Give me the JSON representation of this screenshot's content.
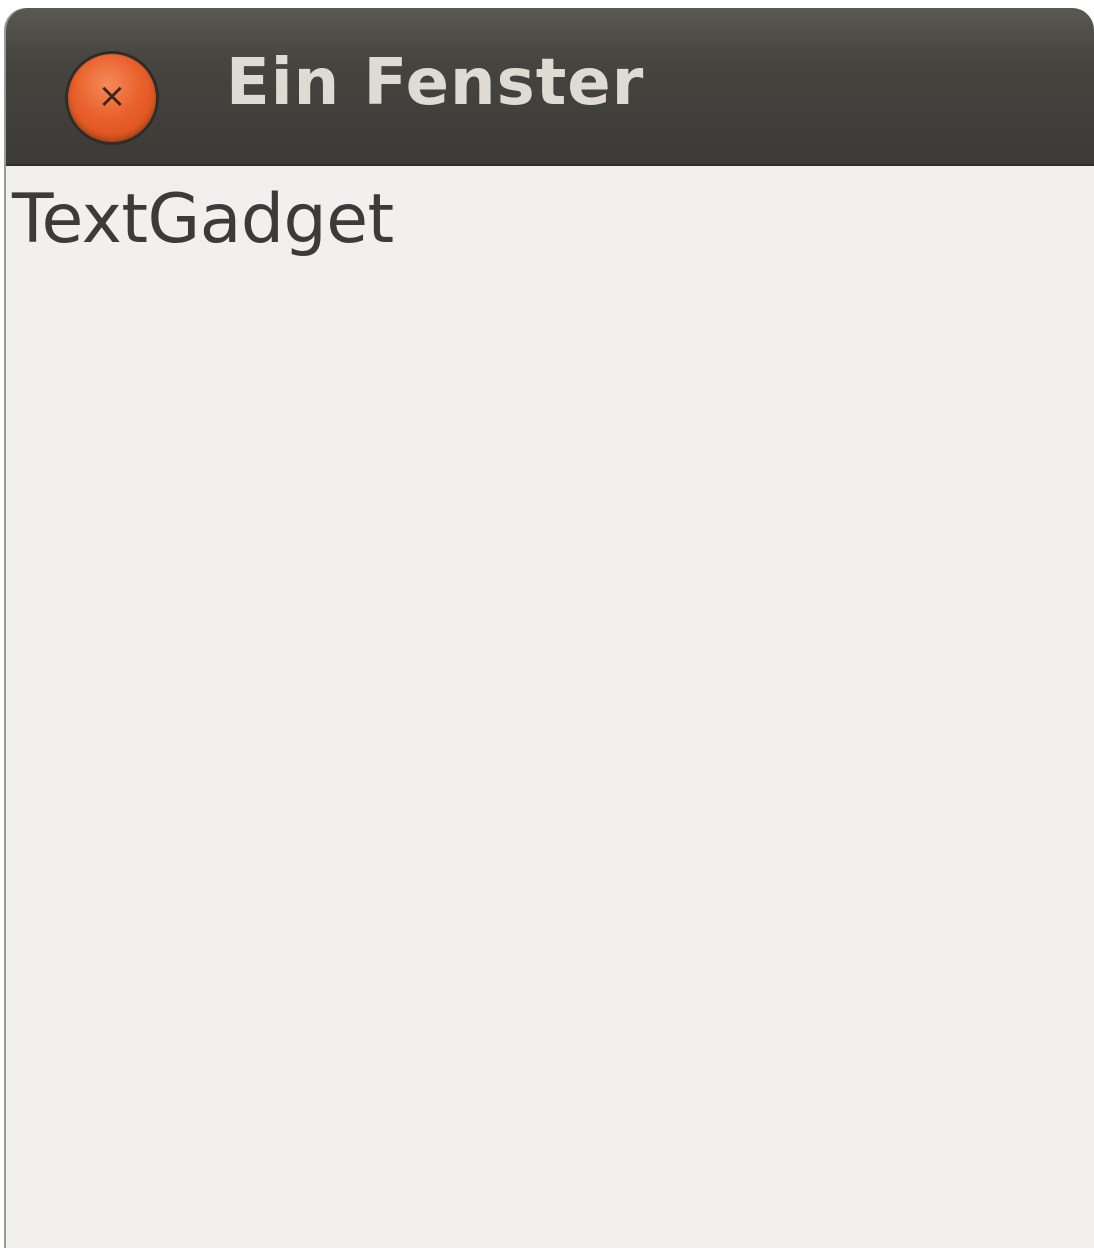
{
  "window": {
    "title": "Ein Fenster",
    "close_icon": "close-icon",
    "close_glyph": "×"
  },
  "content": {
    "text_gadget": "TextGadget"
  },
  "colors": {
    "titlebar": "#3c3b37",
    "title_text": "#dfdbd2",
    "close_button": "#e9602b",
    "content_background": "#f1f0ee",
    "text": "#3c3b37"
  }
}
